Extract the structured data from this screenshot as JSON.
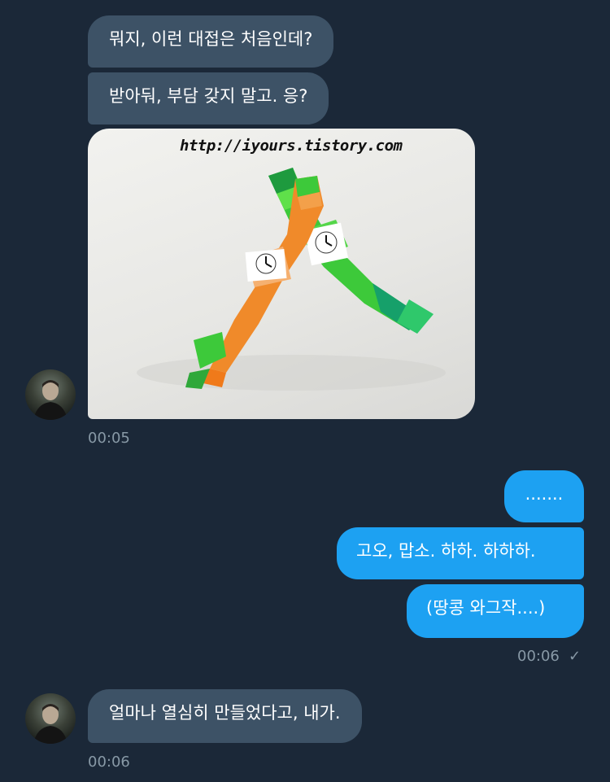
{
  "conversation": {
    "messages": [
      {
        "direction": "in",
        "text": "뭐지, 이런 대접은 처음인데?"
      },
      {
        "direction": "in",
        "text": "받아둬, 부담 갖지 말고. 응?"
      },
      {
        "direction": "in",
        "type": "image",
        "watermark": "http://iyours.tistory.com"
      },
      {
        "direction": "in",
        "time": "00:05"
      },
      {
        "direction": "out",
        "text": "......."
      },
      {
        "direction": "out",
        "text": "고오, 맙소. 하하. 하하하."
      },
      {
        "direction": "out",
        "text": "(땅콩 와그작....)"
      },
      {
        "direction": "out",
        "time": "00:06",
        "read_mark": "✓"
      },
      {
        "direction": "in",
        "text": "얼마나 열심히 만들었다고, 내가."
      },
      {
        "direction": "in",
        "time": "00:06"
      }
    ]
  },
  "colors": {
    "background": "#1b2838",
    "incoming_bubble": "#3d5266",
    "outgoing_bubble": "#1da1f2",
    "timestamp": "#8899a6"
  },
  "icons": {
    "read_receipt": "checkmark-icon",
    "avatar": "user-avatar"
  }
}
